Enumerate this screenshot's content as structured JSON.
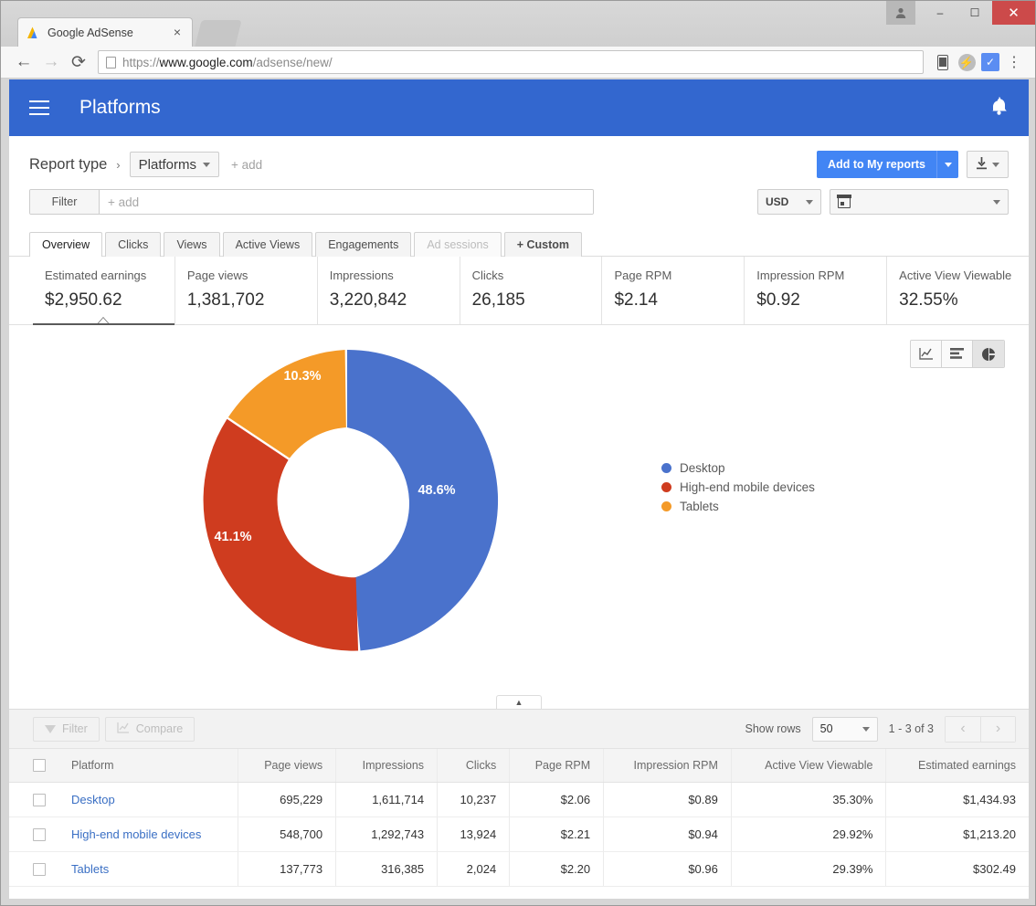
{
  "browser": {
    "tab_title": "Google AdSense",
    "tab_close": "×",
    "back_icon": "←",
    "forward_icon": "→",
    "reload_icon": "⟳",
    "url_scheme": "https://",
    "url_host": "www.google.com",
    "url_path": "/adsense/new/",
    "bolt_icon": "⚡",
    "check_icon": "✓",
    "menu_icon": "⋮",
    "account_icon": "὆4",
    "minimize": "–",
    "maximize": "☐",
    "close": "✕"
  },
  "appbar": {
    "title": "Platforms",
    "notification_icon": "🔔"
  },
  "report": {
    "type_label": "Report type",
    "chevron": "›",
    "selected_type": "Platforms",
    "add_link": "+ add",
    "add_to_my_reports": "Add to My reports",
    "download_icon": "⬇"
  },
  "filter": {
    "tag": "Filter",
    "placeholder": "+ add",
    "currency": "USD",
    "date_range": ""
  },
  "tabs": [
    {
      "label": "Overview",
      "state": "active"
    },
    {
      "label": "Clicks",
      "state": "normal"
    },
    {
      "label": "Views",
      "state": "normal"
    },
    {
      "label": "Active Views",
      "state": "normal"
    },
    {
      "label": "Engagements",
      "state": "normal"
    },
    {
      "label": "Ad sessions",
      "state": "disabled"
    },
    {
      "label": "+  Custom",
      "state": "custom"
    }
  ],
  "metric_cards": [
    {
      "label": "Estimated earnings",
      "value": "$2,950.62",
      "selected": true
    },
    {
      "label": "Page views",
      "value": "1,381,702",
      "selected": false
    },
    {
      "label": "Impressions",
      "value": "3,220,842",
      "selected": false
    },
    {
      "label": "Clicks",
      "value": "26,185",
      "selected": false
    },
    {
      "label": "Page RPM",
      "value": "$2.14",
      "selected": false
    },
    {
      "label": "Impression RPM",
      "value": "$0.92",
      "selected": false
    },
    {
      "label": "Active View Viewable",
      "value": "32.55%",
      "selected": false
    }
  ],
  "view_toggle": [
    {
      "icon": "line-chart-icon",
      "active": false
    },
    {
      "icon": "bar-chart-icon",
      "active": false
    },
    {
      "icon": "pie-chart-icon",
      "active": true
    }
  ],
  "chart_data": {
    "type": "pie",
    "title": "",
    "variant": "donut",
    "categories": [
      "Desktop",
      "High-end mobile devices",
      "Tablets"
    ],
    "values": [
      48.6,
      41.1,
      10.3
    ],
    "labels": [
      "48.6%",
      "41.1%",
      "10.3%"
    ],
    "colors": [
      "#4a72cc",
      "#cf3c1f",
      "#f49a28"
    ],
    "legend_position": "right",
    "legend": [
      "Desktop",
      "High-end mobile devices",
      "Tablets"
    ],
    "metric": "Estimated earnings",
    "start_angle": 0,
    "direction": "clockwise"
  },
  "collapse_icon": "▲",
  "table_toolbar": {
    "filter_label": "Filter",
    "compare_label": "Compare",
    "show_rows_label": "Show rows",
    "rows_value": "50",
    "page_info": "1 - 3 of 3",
    "prev_icon": "‹",
    "next_icon": "›"
  },
  "table": {
    "columns": [
      "Platform",
      "Page views",
      "Impressions",
      "Clicks",
      "Page RPM",
      "Impression RPM",
      "Active View Viewable",
      "Estimated earnings"
    ],
    "rows": [
      {
        "platform": "Desktop",
        "page_views": "695,229",
        "impressions": "1,611,714",
        "clicks": "10,237",
        "page_rpm": "$2.06",
        "impression_rpm": "$0.89",
        "active_view_viewable": "35.30%",
        "estimated_earnings": "$1,434.93"
      },
      {
        "platform": "High-end mobile devices",
        "page_views": "548,700",
        "impressions": "1,292,743",
        "clicks": "13,924",
        "page_rpm": "$2.21",
        "impression_rpm": "$0.94",
        "active_view_viewable": "29.92%",
        "estimated_earnings": "$1,213.20"
      },
      {
        "platform": "Tablets",
        "page_views": "137,773",
        "impressions": "316,385",
        "clicks": "2,024",
        "page_rpm": "$2.20",
        "impression_rpm": "$0.96",
        "active_view_viewable": "29.39%",
        "estimated_earnings": "$302.49"
      }
    ]
  },
  "colors": {
    "appbar_blue": "#3367cf",
    "action_blue": "#4285f4",
    "link_blue": "#3a6fc4",
    "series_blue": "#4a72cc",
    "series_red": "#cf3c1f",
    "series_orange": "#f49a28"
  }
}
